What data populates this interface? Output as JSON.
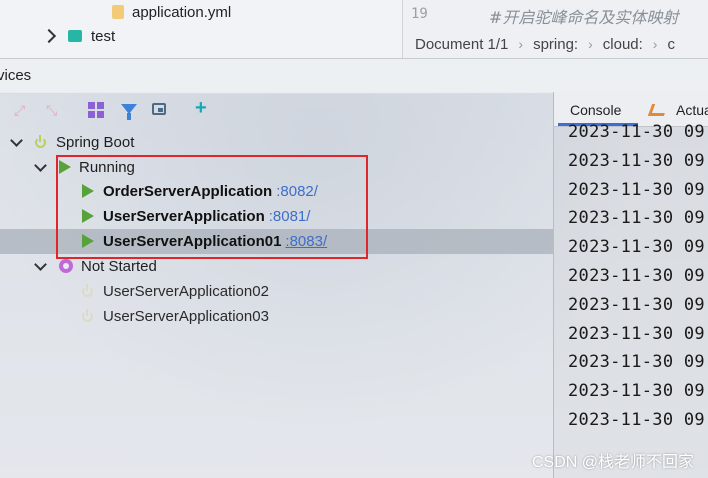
{
  "project_tree": {
    "file_item": "application.yml",
    "folder_item": "test"
  },
  "editor": {
    "line_number": "19",
    "code_comment": "#开启驼峰命名及实体映射",
    "breadcrumbs": [
      "Document 1/1",
      "spring:",
      "cloud:",
      "c"
    ]
  },
  "services": {
    "title": "vices",
    "tree": {
      "root": "Spring Boot",
      "running_group": "Running",
      "running": [
        {
          "name": "OrderServerApplication",
          "port": ":8082/"
        },
        {
          "name": "UserServerApplication",
          "port": ":8081/"
        },
        {
          "name": "UserServerApplication01",
          "port": ":8083/"
        }
      ],
      "not_started_group": "Not Started",
      "not_started": [
        "UserServerApplication02",
        "UserServerApplication03"
      ]
    }
  },
  "console": {
    "tabs": [
      "Console",
      "Actua"
    ],
    "log_lines": [
      "2023-11-30 09",
      "2023-11-30 09",
      "2023-11-30 09",
      "2023-11-30 09",
      "2023-11-30 09",
      "2023-11-30 09",
      "2023-11-30 09",
      "2023-11-30 09",
      "2023-11-30 09",
      "2023-11-30 09",
      "2023-11-30 09"
    ]
  },
  "watermark": "CSDN @栈老师不回家",
  "colors": {
    "highlight_box": "#e0262a",
    "port_link": "#3d6ec9",
    "running_icon": "#58a23a",
    "spring_icon": "#b7d25a",
    "not_started_icon": "#c06ad8"
  }
}
